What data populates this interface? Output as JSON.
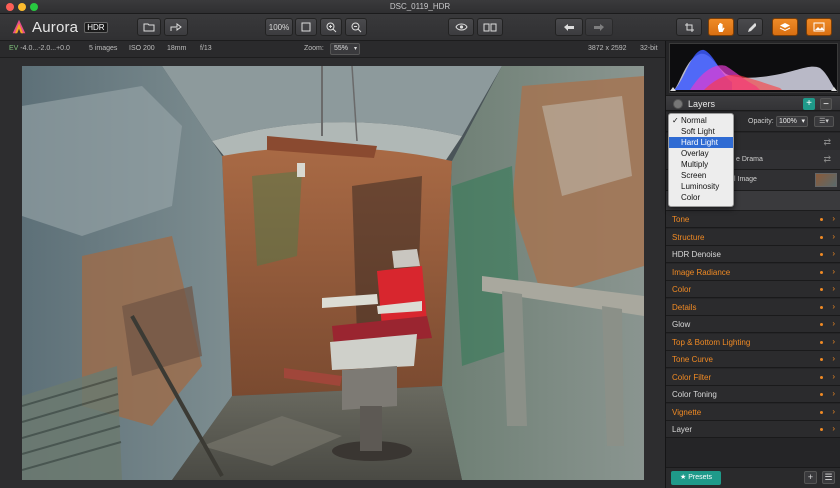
{
  "window": {
    "title": "DSC_0119_HDR"
  },
  "app": {
    "name": "Aurora",
    "badge": "HDR"
  },
  "toolbar": {
    "zoom_fit_label": "100%",
    "icons": [
      "open-file-icon",
      "share-icon",
      "fit-icon",
      "zoom-in-icon",
      "zoom-out-icon",
      "eye-icon",
      "compare-icon",
      "undo-icon",
      "redo-icon",
      "crop-icon",
      "hand-icon",
      "brush-icon",
      "layers-icon",
      "image-icon"
    ]
  },
  "info": {
    "ev_label": "EV",
    "ev_values": "-4.0...-2.0...+0.0",
    "images": "5 images",
    "iso": "ISO 200",
    "focal": "18mm",
    "aperture": "f/13",
    "zoom_label": "Zoom:",
    "zoom_value": "55%",
    "dimensions": "3872 x 2592",
    "bit_depth": "32-bit"
  },
  "layers": {
    "title": "Layers",
    "opacity_label": "Opacity:",
    "opacity_value": "100%",
    "layer_rows": [
      {
        "name": "e Drama"
      },
      {
        "name": "l Image"
      }
    ]
  },
  "blend_menu": {
    "items": [
      "Normal",
      "Soft Light",
      "Hard Light",
      "Overlay",
      "Multiply",
      "Screen",
      "Luminosity",
      "Color"
    ],
    "checked": "Normal",
    "highlighted": "Hard Light"
  },
  "adjustments": [
    {
      "label": "Tone",
      "color": "#f08a24"
    },
    {
      "label": "Structure",
      "color": "#f08a24"
    },
    {
      "label": "HDR Denoise",
      "color": "#d9d9d9"
    },
    {
      "label": "Image Radiance",
      "color": "#f08a24"
    },
    {
      "label": "Color",
      "color": "#f08a24"
    },
    {
      "label": "Details",
      "color": "#f08a24"
    },
    {
      "label": "Glow",
      "color": "#d9d9d9"
    },
    {
      "label": "Top & Bottom Lighting",
      "color": "#f08a24"
    },
    {
      "label": "Tone Curve",
      "color": "#f08a24"
    },
    {
      "label": "Color Filter",
      "color": "#f08a24"
    },
    {
      "label": "Color Toning",
      "color": "#d9d9d9"
    },
    {
      "label": "Vignette",
      "color": "#f08a24"
    },
    {
      "label": "Layer",
      "color": "#d9d9d9"
    }
  ],
  "footer": {
    "presets_label": "★ Presets"
  },
  "colors": {
    "accent": "#f08a24",
    "teal": "#1f9a8a",
    "selection": "#2f6bd3"
  }
}
